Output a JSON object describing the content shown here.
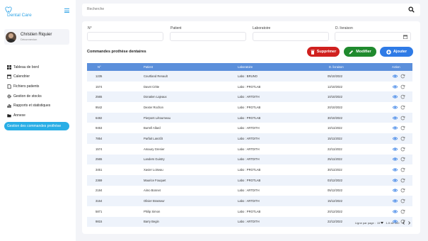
{
  "brand": {
    "name": "Dental Care",
    "color": "#2ea3e6"
  },
  "profile": {
    "name": "Christien Riquier",
    "role": "Déconnexion"
  },
  "nav": [
    {
      "label": "Tableau de bord",
      "icon": "dashboard-icon"
    },
    {
      "label": "Calendrier",
      "icon": "calendar-icon"
    },
    {
      "label": "Fichiers patients",
      "icon": "file-icon"
    },
    {
      "label": "Gestion de stocks",
      "icon": "gear-icon"
    },
    {
      "label": "Rapports et statistiques",
      "icon": "bar-chart-icon"
    },
    {
      "label": "Annexe",
      "icon": "folder-icon"
    },
    {
      "label": "Gestion des commandes prothèse",
      "icon": "",
      "active": true
    }
  ],
  "search": {
    "placeholder": "Recherche",
    "icon": "search-icon"
  },
  "filters": {
    "num_label": "N°",
    "patient_label": "Patient",
    "lab_label": "Laboratoire",
    "date_label": "D. livraison",
    "date_icon": "calendar-icon"
  },
  "section_title": "Commandes prothèse dentaires",
  "buttons": {
    "delete": "Supprimer",
    "modify": "Modifier",
    "add": "Ajouter"
  },
  "colors": {
    "delete": "#d0211f",
    "modify": "#1f8a2e",
    "add": "#2f7be6",
    "header": "#5b8fdb",
    "active_nav": "#29aee6"
  },
  "table": {
    "headers": [
      "N°",
      "Patient",
      "Laboratoire",
      "D. livraison",
      "Action"
    ],
    "rows": [
      [
        "1235",
        "Courtland Renault",
        "Labo : BRUNO",
        "05/10/2022"
      ],
      [
        "1574",
        "Davet Critte",
        "Labo : PROTLAB",
        "12/10/2022"
      ],
      [
        "2565",
        "Donatien Lajeaux",
        "Labo : ARTDITH",
        "10/10/2022"
      ],
      [
        "9542",
        "Dexter Rochon",
        "Labo : PROTLAB",
        "20/10/2022"
      ],
      [
        "6482",
        "Pierpont Létourneau",
        "Labo : PROTLAB",
        "30/10/2022"
      ],
      [
        "9453",
        "Burrell Allard",
        "Labo : ARTDITH",
        "10/11/2022"
      ],
      [
        "7854",
        "Parfait Lanctôt",
        "Labo : ARTDITH",
        "15/11/2022"
      ],
      [
        "1574",
        "Amaury Grenier",
        "Labo : ARTDITH",
        "22/11/2022"
      ],
      [
        "2565",
        "Landers Guistry",
        "Labo : ARTDITH",
        "25/11/2022"
      ],
      [
        "3451",
        "Xavier Loiseau",
        "Labo : PROTLAB",
        "30/11/2022"
      ],
      [
        "2369",
        "Maurice Fouquet",
        "Labo : PROTLAB",
        "03/12/2022"
      ],
      [
        "2184",
        "Aimo Bonnet",
        "Labo : ARTDITH",
        "05/12/2022"
      ],
      [
        "3164",
        "Olivier Brasseur",
        "Labo : ARTDITH",
        "15/12/2022"
      ],
      [
        "5871",
        "Philip Simon",
        "Labo : PROTLAB",
        "20/12/2022"
      ],
      [
        "9815",
        "Barry Begin",
        "Labo : ARTDITH",
        "22/12/2022"
      ]
    ],
    "action_icons": [
      "eye-icon",
      "refresh-icon"
    ]
  },
  "pagination": {
    "rows_label": "Ligne par page :",
    "rows_value": "15",
    "range": "1-5 de 100"
  }
}
